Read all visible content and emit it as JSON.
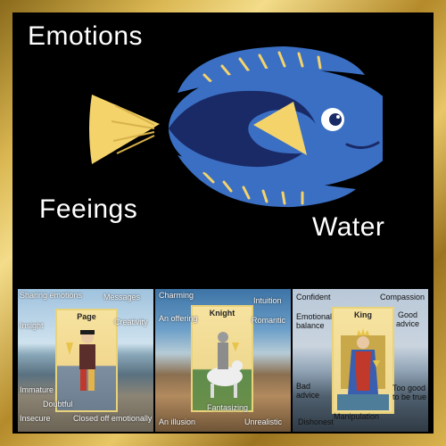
{
  "words": {
    "emotions": "Emotions",
    "feelings": "Feeings",
    "water": "Water"
  },
  "colors": {
    "fish_body": "#3a6fc4",
    "fish_dark": "#1a2a66",
    "fish_yellow": "#f4d36b",
    "frame_gold": "#d9b650"
  },
  "panels": {
    "page": {
      "title": "Page",
      "tags": [
        "Sharing emotions",
        "Messages",
        "Insight",
        "Creativity",
        "Immature",
        "Doubtful",
        "Insecure",
        "Closed off emotionally"
      ]
    },
    "knight": {
      "title": "Knight",
      "tags": [
        "Charming",
        "Intuition",
        "An offering",
        "Romantic",
        "Fantasizing",
        "An illusion",
        "Unrealistic"
      ]
    },
    "king": {
      "title": "King",
      "tags": [
        "Confident",
        "Compassion",
        "Emotional balance",
        "Good advice",
        "Bad advice",
        "Too good to be true",
        "Manipulation",
        "Dishonest"
      ]
    }
  }
}
